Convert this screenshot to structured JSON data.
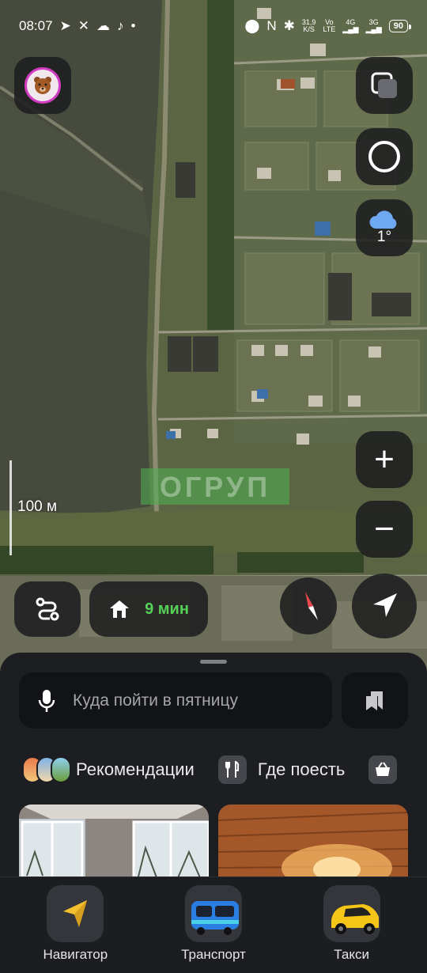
{
  "status_bar": {
    "time": "08:07",
    "net_speed_value": "31,9",
    "net_speed_unit": "K/S",
    "volte_top": "Vo",
    "volte_bottom": "LTE",
    "sim1": "4G",
    "sim2": "3G",
    "battery": "90"
  },
  "map": {
    "watermark": "ОГРУП",
    "scale_label": "100 м",
    "weather_temp": "1°",
    "zoom_in_label": "+",
    "zoom_out_label": "−",
    "home_eta": "9 мин"
  },
  "sheet": {
    "search_placeholder": "Куда пойти в пятницу",
    "chips": [
      {
        "label": "Рекомендации"
      },
      {
        "label": "Где поесть"
      }
    ]
  },
  "tabs": [
    {
      "label": "Навигатор",
      "icon": "navigator-arrow-icon"
    },
    {
      "label": "Транспорт",
      "icon": "bus-icon"
    },
    {
      "label": "Такси",
      "icon": "taxi-car-icon"
    }
  ],
  "colors": {
    "eta_green": "#57d157",
    "accent_pink": "#d23cc0",
    "compass_red": "#e5484d",
    "weather_blue": "#6ea8f0"
  }
}
